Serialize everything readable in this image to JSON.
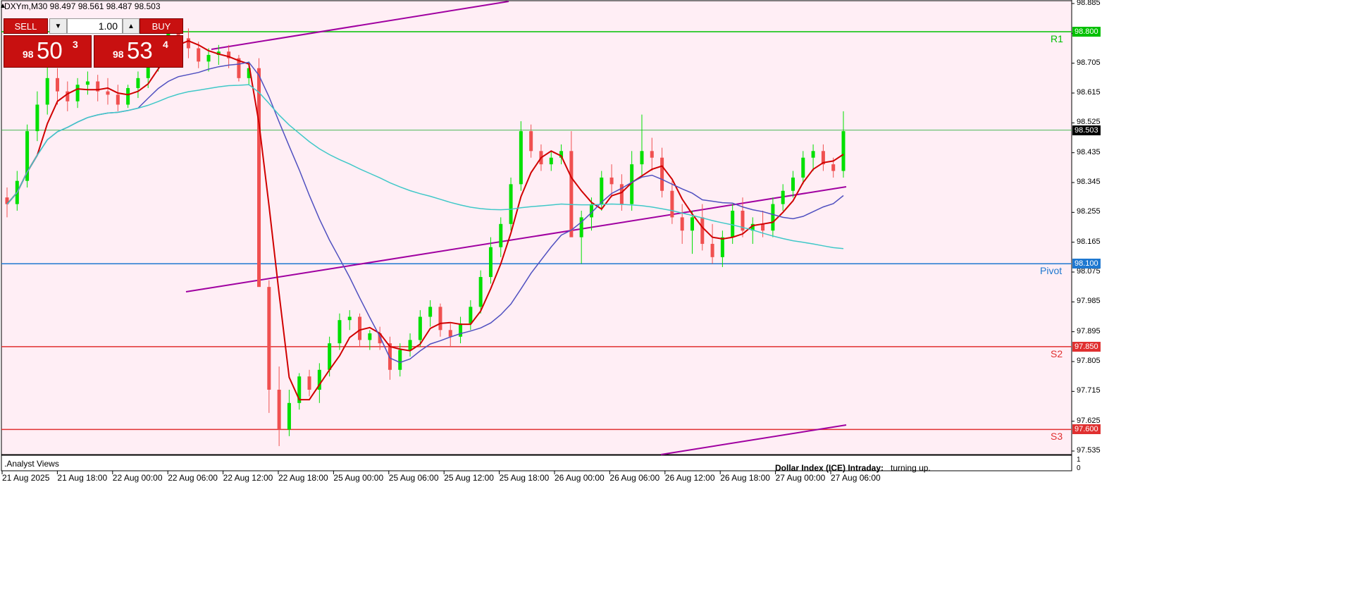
{
  "header": {
    "title": "DXYm,M30  98.497 98.561 98.487 98.503"
  },
  "trade_panel": {
    "sell_label": "SELL",
    "buy_label": "BUY",
    "lot_value": "1.00",
    "sell_price": {
      "prefix": "98",
      "big": "50",
      "sup": "3"
    },
    "buy_price": {
      "prefix": "98",
      "big": "53",
      "sup": "4"
    }
  },
  "price_axis": {
    "labels": [
      "98.885",
      "98.795",
      "98.705",
      "98.615",
      "98.525",
      "98.435",
      "98.345",
      "98.255",
      "98.165",
      "98.075",
      "97.985",
      "97.895",
      "97.805",
      "97.715",
      "97.625",
      "97.535"
    ],
    "current_price": "98.503"
  },
  "levels": [
    {
      "name": "R1",
      "price": 98.8,
      "tag": "98.800",
      "color": "#00c000"
    },
    {
      "name": "Pivot",
      "price": 98.1,
      "tag": "98.100",
      "color": "#1e78d0"
    },
    {
      "name": "S2",
      "price": 97.85,
      "tag": "97.850",
      "color": "#e03030"
    },
    {
      "name": "S3",
      "price": 97.6,
      "tag": "97.600",
      "color": "#e03030"
    }
  ],
  "time_axis": {
    "labels": [
      "21 Aug 2025",
      "21 Aug 18:00",
      "22 Aug 00:00",
      "22 Aug 06:00",
      "22 Aug 12:00",
      "22 Aug 18:00",
      "25 Aug 00:00",
      "25 Aug 06:00",
      "25 Aug 12:00",
      "25 Aug 18:00",
      "26 Aug 00:00",
      "26 Aug 06:00",
      "26 Aug 12:00",
      "26 Aug 18:00",
      "27 Aug 00:00",
      "27 Aug 06:00"
    ]
  },
  "subwindow": {
    "label": ".Analyst Views",
    "axis_top": "1",
    "axis_bottom": "0",
    "analyst_title": "Dollar Index (ICE) Intraday:",
    "analyst_text": "turning up."
  },
  "colors": {
    "background": "#ffeef5",
    "bull": "#00e000",
    "bear": "#f05050",
    "ma_fast": "#d00000",
    "ma_mid": "#5050c0",
    "ma_slow": "#40c8c8",
    "trendline": "#a000a0"
  },
  "chart_data": {
    "type": "candlestick",
    "symbol": "DXYm",
    "timeframe": "M30",
    "ylim": [
      97.49,
      98.885
    ],
    "ohlc": [
      [
        98.3,
        98.33,
        98.24,
        98.28
      ],
      [
        98.28,
        98.38,
        98.26,
        98.35
      ],
      [
        98.35,
        98.52,
        98.33,
        98.5
      ],
      [
        98.5,
        98.62,
        98.47,
        98.58
      ],
      [
        98.58,
        98.7,
        98.55,
        98.66
      ],
      [
        98.66,
        98.69,
        98.58,
        98.62
      ],
      [
        98.62,
        98.65,
        98.56,
        98.59
      ],
      [
        98.59,
        98.66,
        98.57,
        98.64
      ],
      [
        98.64,
        98.68,
        98.61,
        98.65
      ],
      [
        98.65,
        98.67,
        98.59,
        98.62
      ],
      [
        98.62,
        98.66,
        98.58,
        98.61
      ],
      [
        98.61,
        98.64,
        98.56,
        98.58
      ],
      [
        98.58,
        98.64,
        98.57,
        98.63
      ],
      [
        98.63,
        98.68,
        98.6,
        98.66
      ],
      [
        98.66,
        98.72,
        98.63,
        98.7
      ],
      [
        98.7,
        98.78,
        98.68,
        98.76
      ],
      [
        98.76,
        98.82,
        98.74,
        98.8
      ],
      [
        98.8,
        98.83,
        98.76,
        98.78
      ],
      [
        98.78,
        98.81,
        98.72,
        98.75
      ],
      [
        98.75,
        98.77,
        98.69,
        98.71
      ],
      [
        98.71,
        98.75,
        98.68,
        98.73
      ],
      [
        98.73,
        98.76,
        98.7,
        98.74
      ],
      [
        98.74,
        98.76,
        98.69,
        98.72
      ],
      [
        98.72,
        98.73,
        98.65,
        98.66
      ],
      [
        98.66,
        98.71,
        98.64,
        98.69
      ],
      [
        98.69,
        98.72,
        98.61,
        98.03
      ],
      [
        98.03,
        98.05,
        97.65,
        97.72
      ],
      [
        97.72,
        97.79,
        97.55,
        97.6
      ],
      [
        97.6,
        97.72,
        97.58,
        97.68
      ],
      [
        97.68,
        97.77,
        97.66,
        97.76
      ],
      [
        97.76,
        97.78,
        97.7,
        97.72
      ],
      [
        97.72,
        97.8,
        97.68,
        97.78
      ],
      [
        97.78,
        97.88,
        97.76,
        97.86
      ],
      [
        97.86,
        97.95,
        97.84,
        97.93
      ],
      [
        97.93,
        97.96,
        97.9,
        97.94
      ],
      [
        97.94,
        97.95,
        97.85,
        97.87
      ],
      [
        97.87,
        97.9,
        97.84,
        97.89
      ],
      [
        97.89,
        97.91,
        97.84,
        97.86
      ],
      [
        97.86,
        97.88,
        97.75,
        97.78
      ],
      [
        97.78,
        97.86,
        97.76,
        97.84
      ],
      [
        97.84,
        97.89,
        97.82,
        97.87
      ],
      [
        97.87,
        97.96,
        97.85,
        97.94
      ],
      [
        97.94,
        97.99,
        97.91,
        97.97
      ],
      [
        97.97,
        97.98,
        97.88,
        97.9
      ],
      [
        97.9,
        97.92,
        97.85,
        97.88
      ],
      [
        97.88,
        97.94,
        97.86,
        97.92
      ],
      [
        97.92,
        97.99,
        97.9,
        97.97
      ],
      [
        97.97,
        98.08,
        97.95,
        98.06
      ],
      [
        98.06,
        98.18,
        98.04,
        98.15
      ],
      [
        98.15,
        98.24,
        98.12,
        98.22
      ],
      [
        98.22,
        98.36,
        98.2,
        98.34
      ],
      [
        98.34,
        98.53,
        98.32,
        98.5
      ],
      [
        98.5,
        98.52,
        98.42,
        98.44
      ],
      [
        98.44,
        98.46,
        98.38,
        98.4
      ],
      [
        98.4,
        98.44,
        98.38,
        98.42
      ],
      [
        98.42,
        98.46,
        98.4,
        98.44
      ],
      [
        98.44,
        98.5,
        98.28,
        98.18
      ],
      [
        98.18,
        98.26,
        98.1,
        98.24
      ],
      [
        98.24,
        98.3,
        98.2,
        98.28
      ],
      [
        98.28,
        98.38,
        98.26,
        98.36
      ],
      [
        98.36,
        98.4,
        98.3,
        98.34
      ],
      [
        98.34,
        98.37,
        98.26,
        98.28
      ],
      [
        98.28,
        98.44,
        98.26,
        98.4
      ],
      [
        98.4,
        98.55,
        98.36,
        98.44
      ],
      [
        98.44,
        98.48,
        98.38,
        98.42
      ],
      [
        98.42,
        98.45,
        98.3,
        98.32
      ],
      [
        98.32,
        98.35,
        98.22,
        98.24
      ],
      [
        98.24,
        98.28,
        98.16,
        98.2
      ],
      [
        98.2,
        98.26,
        98.13,
        98.24
      ],
      [
        98.24,
        98.28,
        98.14,
        98.16
      ],
      [
        98.16,
        98.22,
        98.1,
        98.12
      ],
      [
        98.12,
        98.2,
        98.09,
        98.18
      ],
      [
        98.18,
        98.28,
        98.16,
        98.26
      ],
      [
        98.26,
        98.3,
        98.18,
        98.2
      ],
      [
        98.2,
        98.24,
        98.16,
        98.22
      ],
      [
        98.22,
        98.26,
        98.18,
        98.2
      ],
      [
        98.2,
        98.3,
        98.18,
        98.28
      ],
      [
        98.28,
        98.34,
        98.26,
        98.32
      ],
      [
        98.32,
        98.38,
        98.3,
        98.36
      ],
      [
        98.36,
        98.44,
        98.34,
        98.42
      ],
      [
        98.42,
        98.46,
        98.38,
        98.44
      ],
      [
        98.44,
        98.46,
        98.38,
        98.4
      ],
      [
        98.4,
        98.42,
        98.36,
        98.38
      ],
      [
        98.38,
        98.56,
        98.36,
        98.5
      ]
    ],
    "series": [
      {
        "name": "MA fast",
        "values": []
      },
      {
        "name": "MA mid",
        "values": []
      },
      {
        "name": "MA slow",
        "values": []
      }
    ]
  }
}
